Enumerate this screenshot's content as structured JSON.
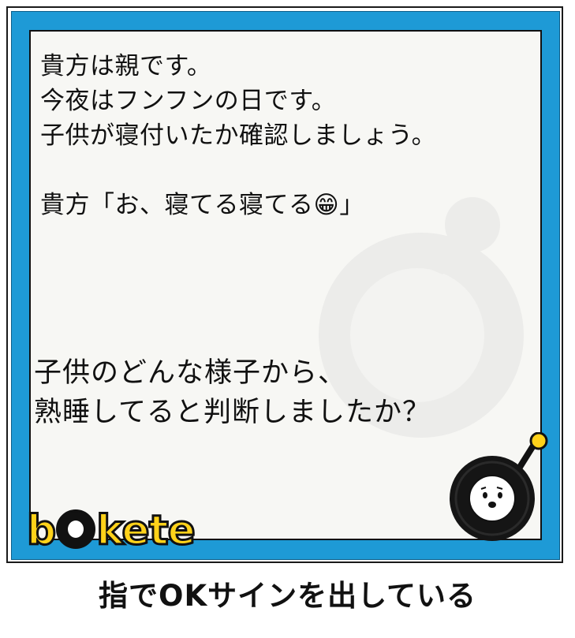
{
  "odai": {
    "text": "貴方は親です。\n今夜はフンフンの日です。\n子供が寝付いたか確認しましょう。\n\n貴方「お、寝てる寝てる😁」",
    "question": "子供のどんな様子から、\n熟睡してると判断しましたか？"
  },
  "logo": {
    "text_b": "b",
    "text_rest": "kete"
  },
  "answer": {
    "text": "指でOKサインを出している"
  },
  "colors": {
    "frame_blue": "#1e9ad6",
    "panel_bg": "#f7f7f4",
    "logo_yellow": "#ffd21a",
    "mascot_bulb": "#ffd21a"
  },
  "icons": {
    "mascot": "boke-bomb-mascot-icon",
    "watermark": "boke-bomb-watermark-icon",
    "logo_o": "bomb-o-icon"
  }
}
